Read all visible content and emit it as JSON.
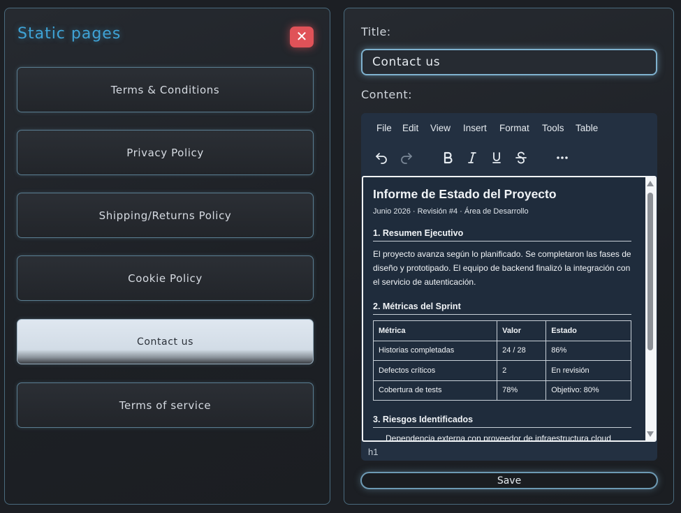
{
  "sidebar": {
    "title": "Static pages",
    "close_glyph": "✕",
    "pages": [
      {
        "label": "Terms & Conditions",
        "active": false
      },
      {
        "label": "Privacy Policy",
        "active": false
      },
      {
        "label": "Shipping/Returns Policy",
        "active": false
      },
      {
        "label": "Cookie Policy",
        "active": false
      },
      {
        "label": "Contact us",
        "active": true
      },
      {
        "label": "Terms of service",
        "active": false
      }
    ]
  },
  "form": {
    "title_label": "Title:",
    "title_value": "Contact us",
    "content_label": "Content:",
    "save_label": "Save"
  },
  "editor": {
    "menu": [
      "File",
      "Edit",
      "View",
      "Insert",
      "Format",
      "Tools",
      "Table"
    ],
    "toolbar": [
      {
        "icon": "undo-icon",
        "enabled": true
      },
      {
        "icon": "redo-icon",
        "enabled": false
      },
      {
        "icon": "bold-icon",
        "enabled": true
      },
      {
        "icon": "italic-icon",
        "enabled": true
      },
      {
        "icon": "underline-icon",
        "enabled": true
      },
      {
        "icon": "strikethrough-icon",
        "enabled": true
      },
      {
        "icon": "more-icon",
        "enabled": true
      }
    ],
    "status_path": "h1",
    "document": {
      "heading": "Informe de Estado del Proyecto",
      "meta": "Junio 2026 · Revisión #4 · Área de Desarrollo",
      "section1_title": "1. Resumen Ejecutivo",
      "section1_body": "El proyecto avanza según lo planificado. Se completaron las fases de diseño y prototipado. El equipo de backend finalizó la integración con el servicio de autenticación.",
      "section2_title": "2. Métricas del Sprint",
      "table": {
        "headers": [
          "Métrica",
          "Valor",
          "Estado"
        ],
        "rows": [
          [
            "Historias completadas",
            "24 / 28",
            "86%"
          ],
          [
            "Defectos críticos",
            "2",
            "En revisión"
          ],
          [
            "Cobertura de tests",
            "78%",
            "Objetivo: 80%"
          ]
        ]
      },
      "section3_title": "3. Riesgos Identificados",
      "section3_item1": "Dependencia externa con proveedor de infraestructura cloud"
    }
  },
  "colors": {
    "accent": "#3fa3d6",
    "close": "#e05258",
    "editor_bg": "#233041"
  }
}
